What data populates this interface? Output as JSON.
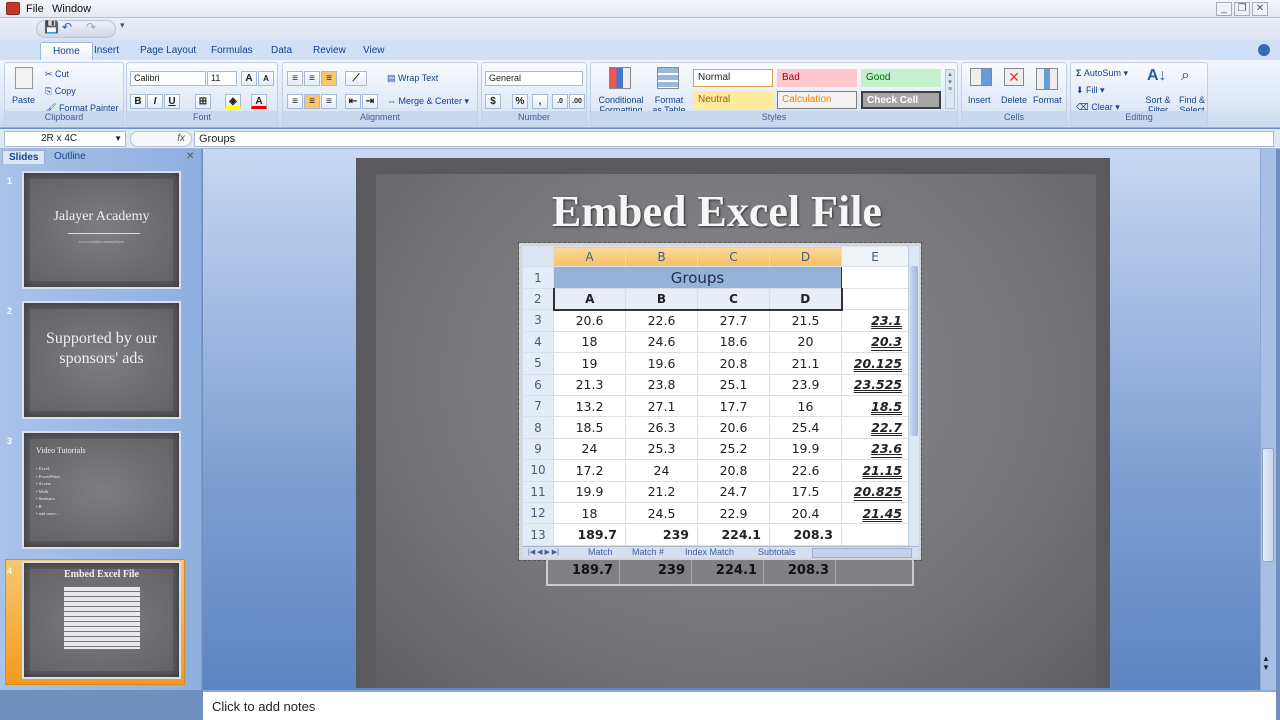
{
  "window": {
    "menu": [
      "File",
      "Window"
    ],
    "controls": [
      "minimize",
      "restore",
      "close"
    ]
  },
  "ribbon_tabs": [
    "Home",
    "Insert",
    "Page Layout",
    "Formulas",
    "Data",
    "Review",
    "View"
  ],
  "ribbon": {
    "clipboard": {
      "label": "Clipboard",
      "paste": "Paste",
      "cut": "Cut",
      "copy": "Copy",
      "format_painter": "Format Painter"
    },
    "font": {
      "label": "Font",
      "font_name": "Calibri",
      "font_size": "11",
      "bold": "B",
      "italic": "I",
      "underline": "U"
    },
    "alignment": {
      "label": "Alignment",
      "wrap_text": "Wrap Text",
      "merge_center": "Merge & Center"
    },
    "number": {
      "label": "Number",
      "format": "General",
      "currency": "$",
      "percent": "%",
      "comma": ","
    },
    "styles": {
      "label": "Styles",
      "conditional": "Conditional Formatting",
      "format_table": "Format as Table",
      "cells": [
        {
          "name": "Normal",
          "bg": "#ffffff",
          "fg": "#222222",
          "border": "#e0a040"
        },
        {
          "name": "Bad",
          "bg": "#ffc7ce",
          "fg": "#9c0006",
          "border": "#ffc7ce"
        },
        {
          "name": "Good",
          "bg": "#c6efce",
          "fg": "#006100",
          "border": "#c6efce"
        },
        {
          "name": "Neutral",
          "bg": "#ffeb9c",
          "fg": "#9c6500",
          "border": "#ffeb9c"
        },
        {
          "name": "Calculation",
          "bg": "#f2f2f2",
          "fg": "#fa7d00",
          "border": "#7f7f7f"
        },
        {
          "name": "Check Cell",
          "bg": "#a5a5a5",
          "fg": "#ffffff",
          "border": "#3f3f3f"
        }
      ]
    },
    "cells": {
      "label": "Cells",
      "insert": "Insert",
      "delete": "Delete",
      "format": "Format"
    },
    "editing": {
      "label": "Editing",
      "autosum": "AutoSum",
      "fill": "Fill",
      "clear": "Clear",
      "sort_filter": "Sort & Filter",
      "find_select": "Find & Select"
    }
  },
  "formula_bar": {
    "name_box": "2R x 4C",
    "fx": "fx",
    "formula": "Groups"
  },
  "left_pane": {
    "tabs": [
      "Slides",
      "Outline"
    ],
    "slides": [
      {
        "num": "1",
        "title": "Jalayer Academy",
        "subtitle": "www.youtube.com/mjalayer"
      },
      {
        "num": "2",
        "title": "Supported by our sponsors' ads"
      },
      {
        "num": "3",
        "title": "Video Tutorials",
        "bullets": [
          "Excel",
          "PowerPoint",
          "Access",
          "Math",
          "Statistics",
          "R",
          "and more..."
        ]
      },
      {
        "num": "4",
        "title": "Embed Excel File",
        "selected": true
      }
    ]
  },
  "slide": {
    "title": "Embed Excel File",
    "excel": {
      "columns": [
        "A",
        "B",
        "C",
        "D",
        "E"
      ],
      "group_header": "Groups",
      "sub_headers": [
        "A",
        "B",
        "C",
        "D"
      ],
      "rows": [
        {
          "row": "3",
          "values": [
            "20.6",
            "22.6",
            "27.7",
            "21.5"
          ],
          "avg": "23.1"
        },
        {
          "row": "4",
          "values": [
            "18",
            "24.6",
            "18.6",
            "20"
          ],
          "avg": "20.3"
        },
        {
          "row": "5",
          "values": [
            "19",
            "19.6",
            "20.8",
            "21.1"
          ],
          "avg": "20.125"
        },
        {
          "row": "6",
          "values": [
            "21.3",
            "23.8",
            "25.1",
            "23.9"
          ],
          "avg": "23.525"
        },
        {
          "row": "7",
          "values": [
            "13.2",
            "27.1",
            "17.7",
            "16"
          ],
          "avg": "18.5"
        },
        {
          "row": "8",
          "values": [
            "18.5",
            "26.3",
            "20.6",
            "25.4"
          ],
          "avg": "22.7"
        },
        {
          "row": "9",
          "values": [
            "24",
            "25.3",
            "25.2",
            "19.9"
          ],
          "avg": "23.6"
        },
        {
          "row": "10",
          "values": [
            "17.2",
            "24",
            "20.8",
            "22.6"
          ],
          "avg": "21.15"
        },
        {
          "row": "11",
          "values": [
            "19.9",
            "21.2",
            "24.7",
            "17.5"
          ],
          "avg": "20.825"
        },
        {
          "row": "12",
          "values": [
            "18",
            "24.5",
            "22.9",
            "20.4"
          ],
          "avg": "21.45"
        }
      ],
      "totals": {
        "row": "13",
        "values": [
          "189.7",
          "239",
          "224.1",
          "208.3"
        ]
      },
      "sheet_tabs": [
        "Match",
        "Match #",
        "Index Match",
        "Subtotals"
      ]
    }
  },
  "notes_placeholder": "Click to add notes"
}
